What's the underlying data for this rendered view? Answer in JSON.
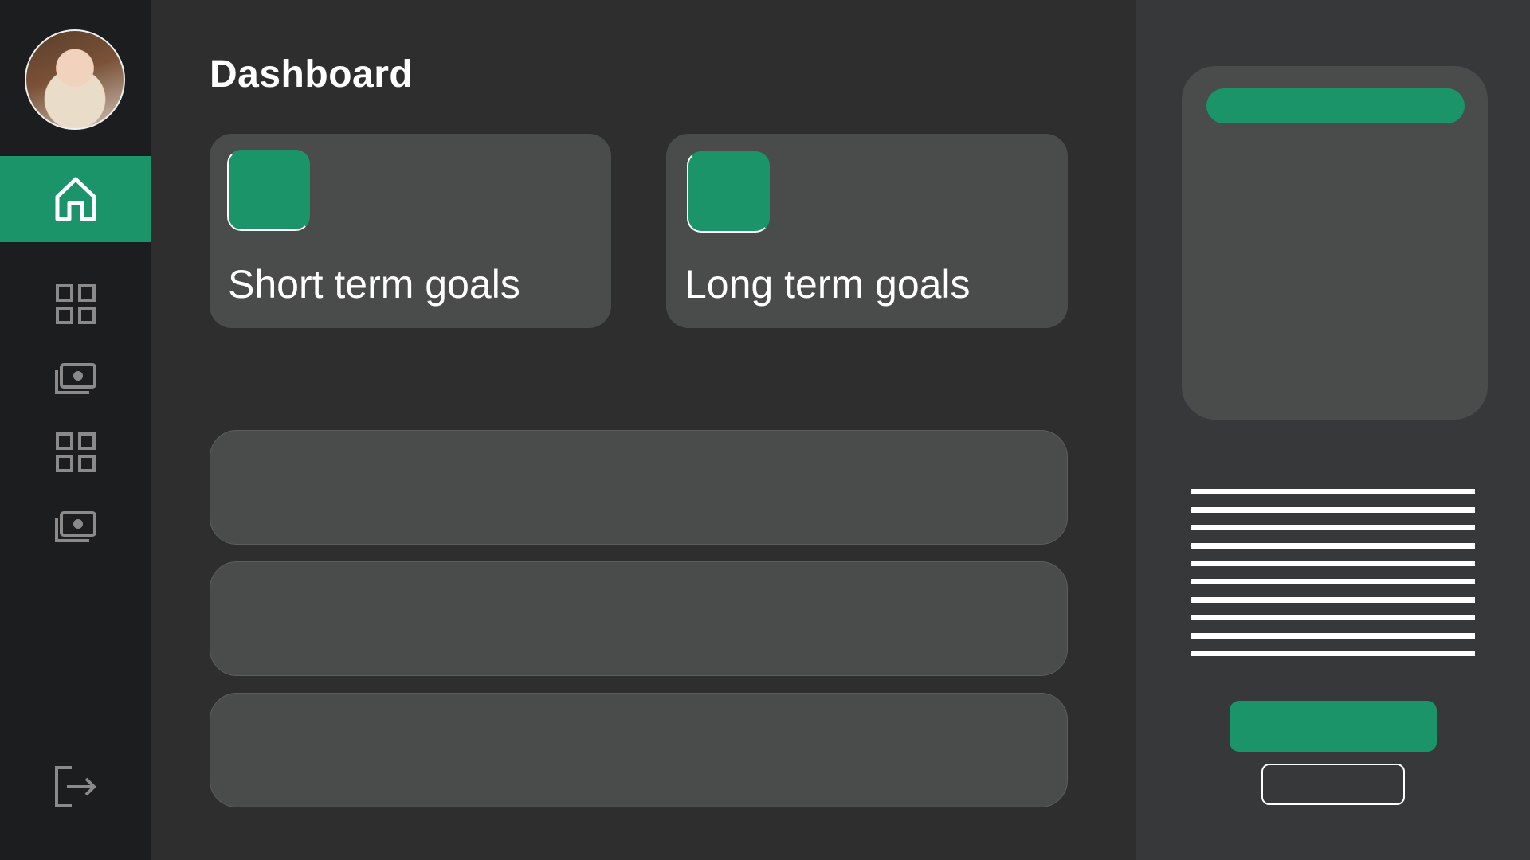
{
  "header": {
    "title": "Dashboard"
  },
  "sidebar": {
    "avatar": "user-avatar-photo",
    "items": [
      {
        "icon": "home-icon",
        "active": true
      },
      {
        "icon": "grid-icon",
        "active": false
      },
      {
        "icon": "cash-icon",
        "active": false
      },
      {
        "icon": "grid-icon",
        "active": false
      },
      {
        "icon": "cash-icon",
        "active": false
      }
    ],
    "logout_icon": "logout-icon"
  },
  "goals": [
    {
      "label": "Short term goals"
    },
    {
      "label": "Long term goals"
    }
  ],
  "list_rows": [
    {},
    {},
    {}
  ],
  "colors": {
    "accent": "#1a9468",
    "sidebar_bg": "#1c1d1f",
    "main_bg": "#2e2e2f",
    "panel_bg": "#37383a",
    "card_bg": "#4a4c4b",
    "icon_gray": "#8a8a8a"
  }
}
